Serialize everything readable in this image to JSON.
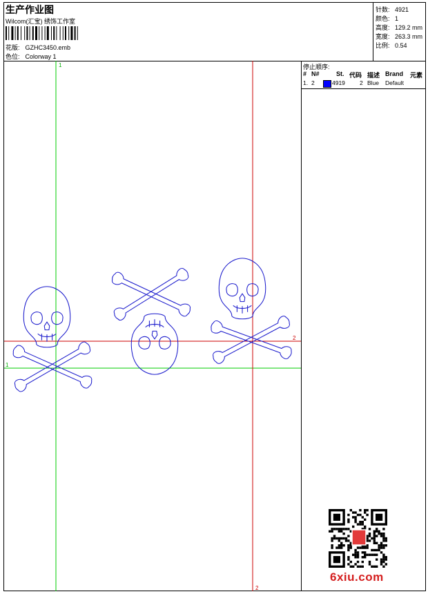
{
  "header": {
    "title": "生产作业图",
    "company": "Wilcom(汇宝) 绣饰工作室",
    "design_label": "花版:",
    "design_value": "GZHC3450.emb",
    "colorway_label": "色位:",
    "colorway_value": "Colorway 1"
  },
  "stats": [
    {
      "label": "针数:",
      "value": "4921"
    },
    {
      "label": "颜色:",
      "value": "1"
    },
    {
      "label": "高度:",
      "value": "129.2 mm"
    },
    {
      "label": "宽度:",
      "value": "263.3 mm"
    },
    {
      "label": "比例:",
      "value": "0.54"
    }
  ],
  "stop_sequence": {
    "title": "停止顺序:",
    "columns": [
      "#",
      "N#",
      "St.",
      "代码",
      "描述",
      "Brand",
      "元素"
    ],
    "rows": [
      {
        "index": "1.",
        "needle": "2",
        "stitches": "4919",
        "code": "2",
        "description": "Blue",
        "brand": "Default",
        "swatch_color": "#0000ff"
      }
    ]
  },
  "canvas": {
    "guide_green_label": "1",
    "guide_red_label": "2",
    "guide_green_color": "#00cc00",
    "guide_red_color": "#cc0000",
    "outline_color": "#1a1acc"
  },
  "watermark": {
    "text": "6xiu.com",
    "color": "#d41d1d"
  }
}
